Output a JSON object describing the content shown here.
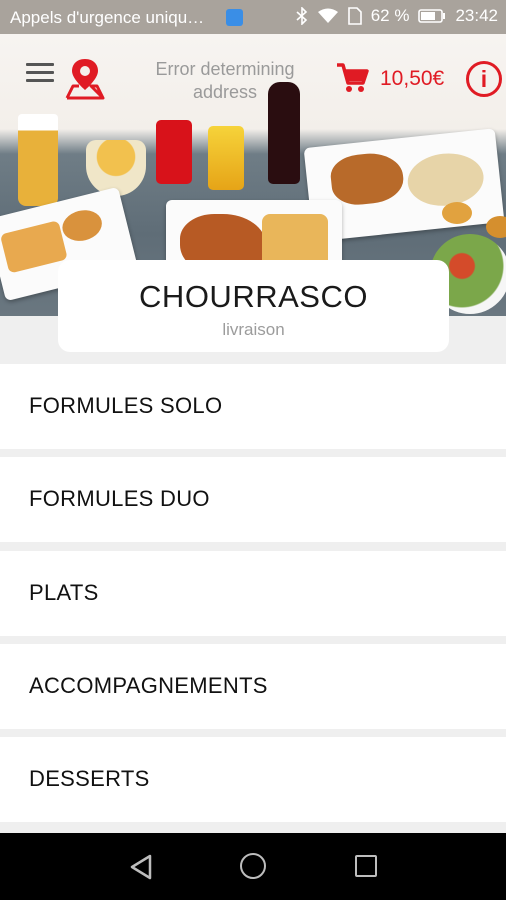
{
  "status_bar": {
    "carrier": "Appels d'urgence uniqu…",
    "battery": "62 %",
    "time": "23:42"
  },
  "header": {
    "address": "Error determining address",
    "cart_total": "10,50€",
    "icons": [
      "menu-icon",
      "location-pin-icon",
      "cart-icon",
      "info-icon"
    ]
  },
  "restaurant": {
    "name": "CHOURRASCO",
    "mode": "livraison"
  },
  "categories": [
    {
      "label": "FORMULES SOLO"
    },
    {
      "label": "FORMULES DUO"
    },
    {
      "label": "PLATS"
    },
    {
      "label": "ACCOMPAGNEMENTS"
    },
    {
      "label": "DESSERTS"
    }
  ],
  "colors": {
    "accent": "#e01b24",
    "status_bar": "#a9a39c"
  }
}
